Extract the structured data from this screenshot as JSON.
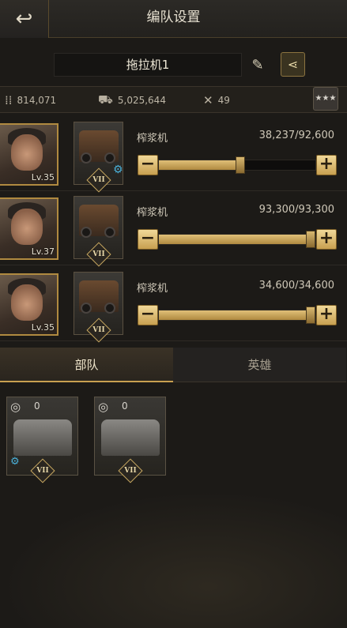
{
  "header": {
    "title": "编队设置",
    "back_icon": "back-arrow-icon"
  },
  "formation": {
    "name": "拖拉机1",
    "edit_icon": "pencil-icon",
    "share_icon": "share-icon"
  },
  "stats": {
    "ammo": {
      "icon": "bullets-icon",
      "value": "814,071"
    },
    "load": {
      "icon": "truck-icon",
      "value": "5,025,644"
    },
    "repair": {
      "icon": "wrench-icon",
      "value": "49"
    },
    "rank_icon": "stars-icon"
  },
  "slots": [
    {
      "hero_level": "Lv.35",
      "unit_name": "榨浆机",
      "count": "38,237/92,600",
      "fill_fraction": 0.52,
      "rank": "VII",
      "gear": true
    },
    {
      "hero_level": "Lv.37",
      "unit_name": "榨浆机",
      "count": "93,300/93,300",
      "fill_fraction": 1.0,
      "rank": "VII",
      "gear": false
    },
    {
      "hero_level": "Lv.35",
      "unit_name": "榨浆机",
      "count": "34,600/34,600",
      "fill_fraction": 1.0,
      "rank": "VII",
      "gear": false
    }
  ],
  "tabs": {
    "troops": "部队",
    "heroes": "英雄"
  },
  "troops": [
    {
      "count": "0",
      "rank": "VII",
      "gear": true
    },
    {
      "count": "0",
      "rank": "VII",
      "gear": false
    }
  ],
  "colors": {
    "accent": "#c8a050",
    "gear": "#4ab0d8",
    "background": "#1c1a17"
  }
}
